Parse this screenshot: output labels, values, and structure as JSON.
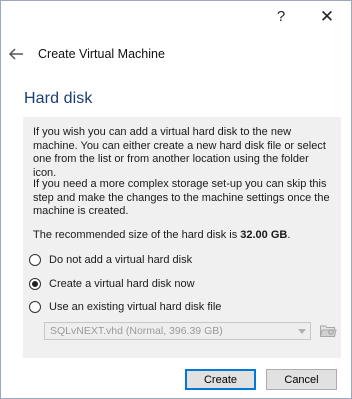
{
  "titlebar": {
    "help_label": "?",
    "close_label": "✕"
  },
  "wizard": {
    "title": "Create Virtual Machine"
  },
  "page": {
    "title": "Hard disk",
    "para1": "If you wish you can add a virtual hard disk to the new machine. You can either create a new hard disk file or select one from the list or from another location using the folder icon.",
    "para2": "If you need a more complex storage set-up you can skip this step and make the changes to the machine settings once the machine is created.",
    "recommended_prefix": "The recommended size of the hard disk is ",
    "recommended_size": "32.00 GB",
    "recommended_suffix": "."
  },
  "options": [
    {
      "label": "Do not add a virtual hard disk",
      "checked": false
    },
    {
      "label": "Create a virtual hard disk now",
      "checked": true
    },
    {
      "label": "Use an existing virtual hard disk file",
      "checked": false
    }
  ],
  "file_select": {
    "value": "SQLvNEXT.vhd (Normal, 396.39 GB)",
    "enabled": false
  },
  "buttons": {
    "create": "Create",
    "cancel": "Cancel"
  },
  "icons": {
    "back": "back-arrow-icon",
    "folder": "folder-icon",
    "help": "help-icon",
    "close": "close-icon"
  }
}
